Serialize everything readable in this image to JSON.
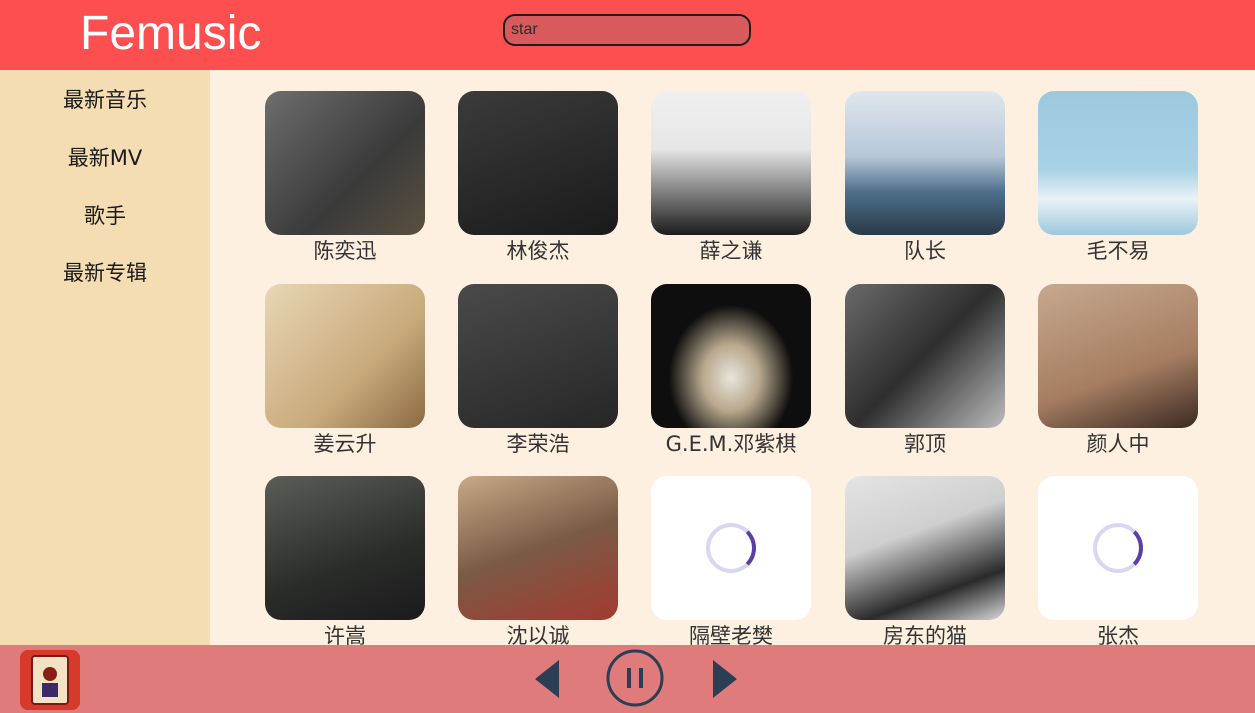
{
  "app": {
    "title": "Femusic"
  },
  "search": {
    "value": "star",
    "placeholder": ""
  },
  "sidebar": {
    "items": [
      {
        "label": "最新音乐"
      },
      {
        "label": "最新MV"
      },
      {
        "label": "歌手"
      },
      {
        "label": "最新专辑"
      }
    ]
  },
  "artists": [
    {
      "name": "陈奕迅"
    },
    {
      "name": "林俊杰"
    },
    {
      "name": "薛之谦"
    },
    {
      "name": "队长"
    },
    {
      "name": "毛不易"
    },
    {
      "name": "姜云升"
    },
    {
      "name": "李荣浩"
    },
    {
      "name": "G.E.M.邓紫棋"
    },
    {
      "name": "郭顶"
    },
    {
      "name": "颜人中"
    },
    {
      "name": "许嵩"
    },
    {
      "name": "沈以诚"
    },
    {
      "name": "隔壁老樊"
    },
    {
      "name": "房东的猫"
    },
    {
      "name": "张杰"
    }
  ],
  "player": {
    "prev_icon": "prev-icon",
    "pause_icon": "pause-icon",
    "next_icon": "next-icon",
    "cover_icon": "album-cover"
  },
  "colors": {
    "header": "#fd4f4f",
    "sidebar": "#f4ddb2",
    "content": "#fdf0e0",
    "footer": "#e07b7b",
    "controls": "#2c3e55"
  }
}
